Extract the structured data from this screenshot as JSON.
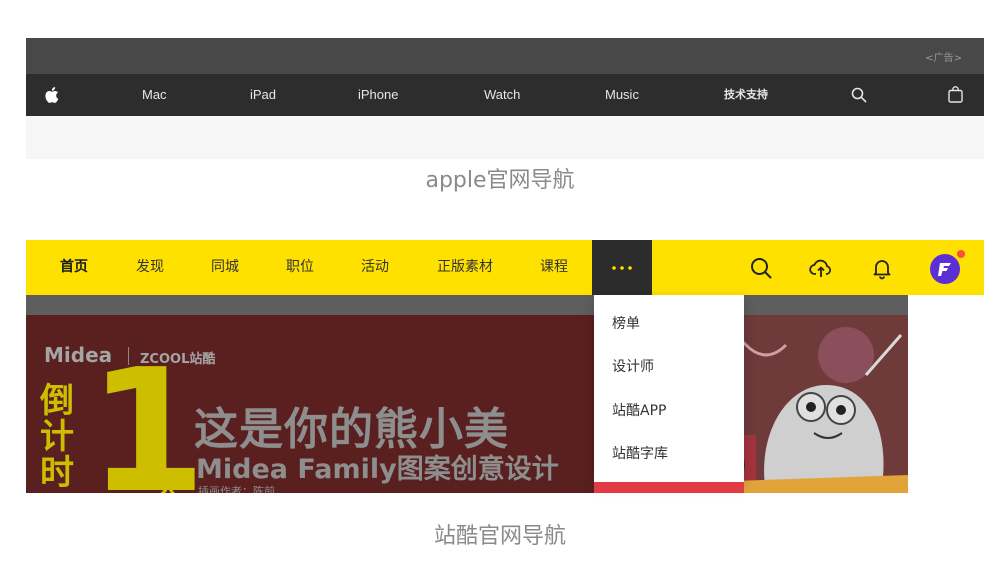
{
  "apple": {
    "ad_label": "<广告>",
    "nav_items": [
      "Mac",
      "iPad",
      "iPhone",
      "Watch",
      "Music",
      "技术支持"
    ],
    "logo_icon": "apple-logo-icon",
    "search_icon": "search-icon",
    "bag_icon": "shopping-bag-icon",
    "caption": "apple官网导航",
    "colors": {
      "ad_bar": "#484848",
      "nav_bar": "#2d2d2d",
      "text": "#e6e6e6"
    }
  },
  "zcool": {
    "nav_items": [
      "首页",
      "发现",
      "同城",
      "职位",
      "活动",
      "正版素材",
      "课程"
    ],
    "active_item": "首页",
    "more_icon": "more-dots-icon",
    "action_icons": [
      "search-icon",
      "upload-cloud-icon",
      "bell-icon"
    ],
    "avatar_icon": "user-avatar-icon",
    "dropdown_items": [
      "榜单",
      "设计师",
      "站酷APP",
      "站酷字库"
    ],
    "banner": {
      "brand": "Midea",
      "brand2": "ZCOOL站酷",
      "countdown": "倒计时",
      "countdown_number": "1",
      "countdown_unit": "天",
      "headline": "这是你的熊小美",
      "subheadline": "Midea Family图案创意设计",
      "credit": "插画作者：陈前"
    },
    "caption": "站酷官网导航",
    "colors": {
      "nav_bar": "#ffe100",
      "more_bg": "#2c2c2c",
      "accent": "#ffe100",
      "avatar": "#5b2fd6",
      "notify": "#ff4d3a"
    }
  }
}
